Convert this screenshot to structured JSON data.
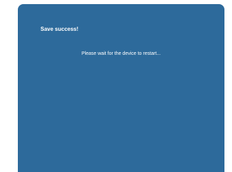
{
  "dialog": {
    "title": "Save success!",
    "message": "Please wait for the device to restart..."
  },
  "colors": {
    "panel_background": "#2d6a9b",
    "text": "#ffffff",
    "page_background": "#ffffff"
  }
}
